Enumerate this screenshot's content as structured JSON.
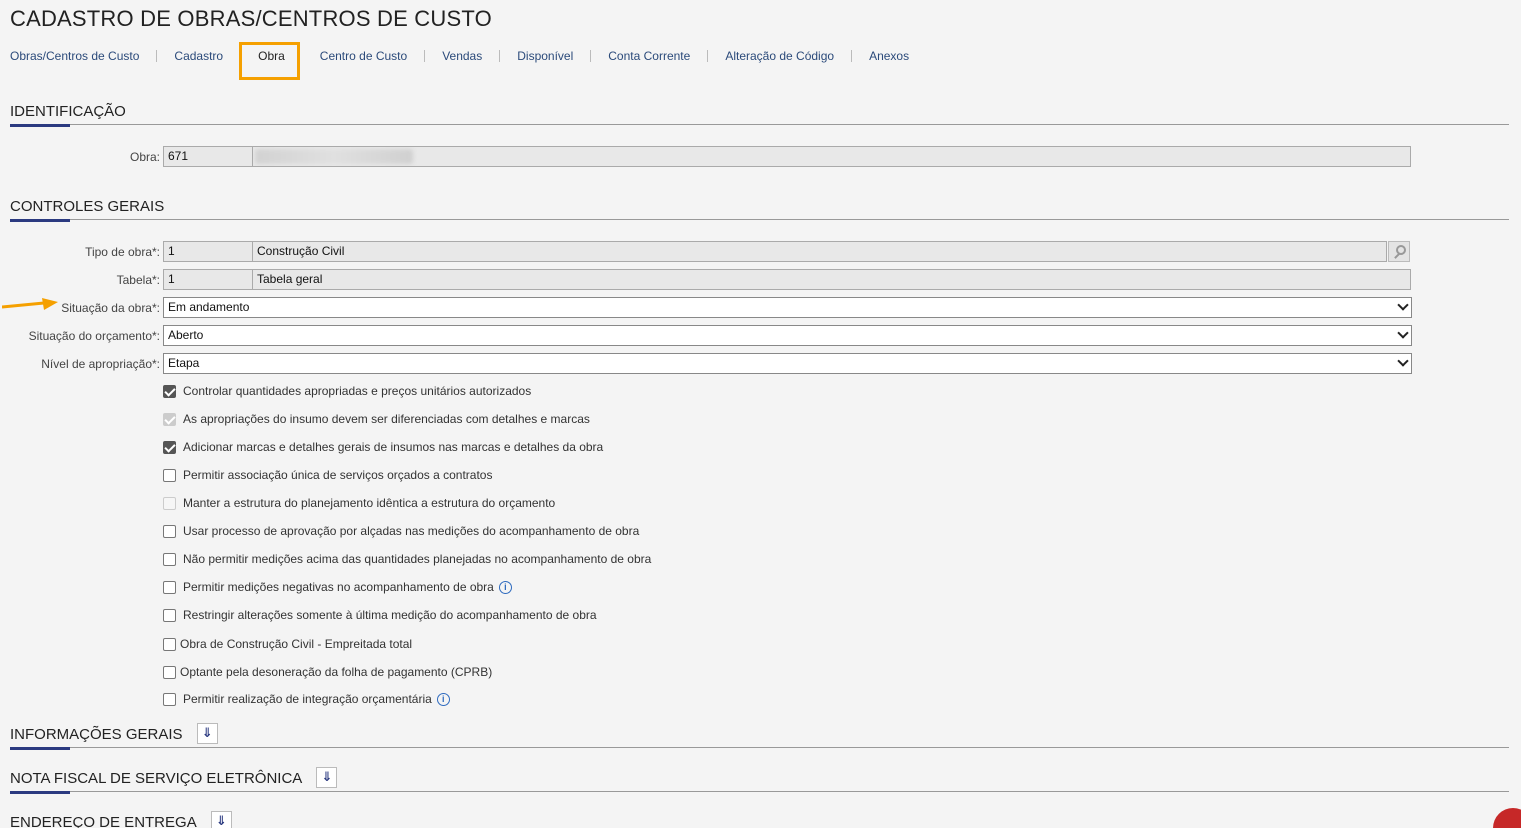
{
  "page": {
    "title": "CADASTRO DE OBRAS/CENTROS DE CUSTO"
  },
  "tabs": [
    {
      "label": "Obras/Centros de Custo"
    },
    {
      "label": "Cadastro"
    },
    {
      "label": "Obra"
    },
    {
      "label": "Centro de Custo"
    },
    {
      "label": "Vendas"
    },
    {
      "label": "Disponível"
    },
    {
      "label": "Conta Corrente"
    },
    {
      "label": "Alteração de Código"
    },
    {
      "label": "Anexos"
    }
  ],
  "active_tab": "Obra",
  "sections": {
    "identificacao": "IDENTIFICAÇÃO",
    "controles": "CONTROLES GERAIS",
    "informacoes": "INFORMAÇÕES GERAIS",
    "nfse": "NOTA FISCAL DE SERVIÇO ELETRÔNICA",
    "endereco": "ENDEREÇO DE ENTREGA"
  },
  "form": {
    "obra": {
      "label": "Obra:",
      "code": "671"
    },
    "tipo_obra": {
      "label": "Tipo de obra*:",
      "code": "1",
      "desc": "Construção Civil"
    },
    "tabela": {
      "label": "Tabela*:",
      "code": "1",
      "desc": "Tabela geral"
    },
    "situacao_obra": {
      "label": "Situação da obra*:",
      "value": "Em andamento"
    },
    "situacao_orcamento": {
      "label": "Situação do orçamento*:",
      "value": "Aberto"
    },
    "nivel_apropriacao": {
      "label": "Nível de apropriação*:",
      "value": "Etapa"
    }
  },
  "checkboxes": [
    {
      "label": "Controlar quantidades apropriadas e preços unitários autorizados",
      "checked": true,
      "disabled": false
    },
    {
      "label": "As apropriações do insumo devem ser diferenciadas com detalhes e marcas",
      "checked": true,
      "disabled": true
    },
    {
      "label": "Adicionar marcas e detalhes gerais de insumos nas marcas e detalhes da obra",
      "checked": true,
      "disabled": false
    },
    {
      "label": "Permitir associação única de serviços orçados a contratos",
      "checked": false,
      "disabled": false
    },
    {
      "label": "Manter a estrutura do planejamento idêntica a estrutura do orçamento",
      "checked": false,
      "disabled": true
    },
    {
      "label": "Usar processo de aprovação por alçadas nas medições do acompanhamento de obra",
      "checked": false,
      "disabled": false
    },
    {
      "label": "Não permitir medições acima das quantidades planejadas no acompanhamento de obra",
      "checked": false,
      "disabled": false
    },
    {
      "label": "Permitir medições negativas no acompanhamento de obra",
      "checked": false,
      "disabled": false
    },
    {
      "label": "Restringir alterações somente à última medição do acompanhamento de obra",
      "checked": false,
      "disabled": false
    },
    {
      "label": "Obra de Construção Civil - Empreitada total",
      "checked": false,
      "disabled": false
    },
    {
      "label": "Optante pela desoneração da folha de pagamento (CPRB)",
      "checked": false,
      "disabled": false
    },
    {
      "label": "Permitir realização de integração orçamentária",
      "checked": false,
      "disabled": false
    }
  ],
  "icons": {
    "lookup": "search-icon",
    "info": "info-icon",
    "expand": "double-chevron-down-icon",
    "annotation": "arrow-right-icon"
  },
  "colors": {
    "accent": "#2b3a80",
    "highlight": "#f5a000",
    "link": "#2b4a7a",
    "info": "#2f6bbf"
  }
}
